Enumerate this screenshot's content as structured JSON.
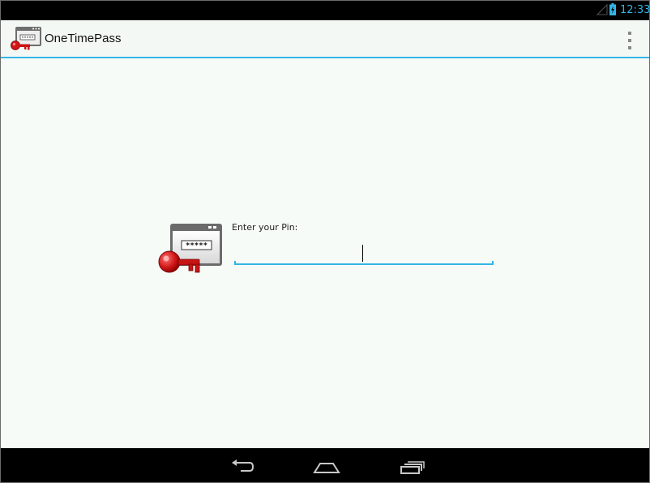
{
  "status_bar": {
    "time": "12:33",
    "icons": [
      "signal-icon",
      "battery-charging-icon"
    ]
  },
  "action_bar": {
    "app_icon": "pin-key-app-icon",
    "title": "OneTimePass",
    "overflow_icon": "overflow-menu-icon"
  },
  "pin_form": {
    "illustration": "password-window-key-icon",
    "illustration_text": "*****",
    "label": "Enter your Pin:",
    "value": ""
  },
  "nav_bar": {
    "buttons": [
      "back-icon",
      "home-icon",
      "recent-apps-icon"
    ]
  },
  "colors": {
    "accent": "#33b5e5",
    "background": "#f6fbf8",
    "key_red": "#d01818"
  }
}
